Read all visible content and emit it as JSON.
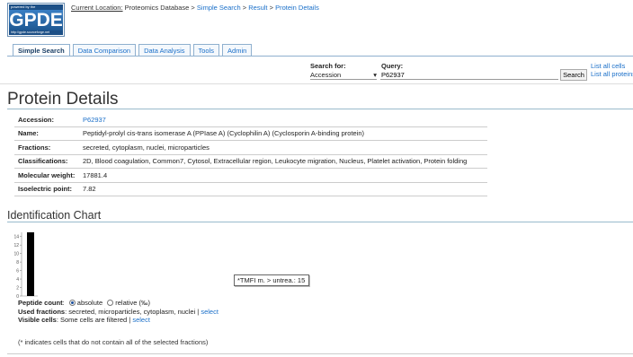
{
  "logo": {
    "top": "powered by the",
    "main": "GPDE",
    "bottom": "http://gpde.sourceforge.net"
  },
  "location": {
    "label": "Current Location:",
    "path": [
      "Proteomics Database",
      "Simple Search",
      "Result",
      "Protein Details"
    ],
    "separator": " > "
  },
  "tabs": [
    {
      "label": "Simple Search",
      "active": true
    },
    {
      "label": "Data Comparison",
      "active": false
    },
    {
      "label": "Data Analysis",
      "active": false
    },
    {
      "label": "Tools",
      "active": false
    },
    {
      "label": "Admin",
      "active": false
    }
  ],
  "search": {
    "for_label": "Search for:",
    "for_value": "Accession",
    "query_label": "Query:",
    "query_value": "P62937",
    "button": "Search",
    "list_cells": "List all cells",
    "list_proteins": "List all proteins"
  },
  "page_title": "Protein Details",
  "details": [
    {
      "key": "Accession:",
      "value": "P62937",
      "link": true
    },
    {
      "key": "Name:",
      "value": "Peptidyl-prolyl cis-trans isomerase A (PPIase A) (Cyclophilin A) (Cyclosporin A-binding protein)",
      "link": false
    },
    {
      "key": "Fractions:",
      "value": "secreted, cytoplasm, nuclei, microparticles",
      "link": false
    },
    {
      "key": "Classifications:",
      "value": "2D, Blood coagulation, Common7, Cytosol, Extracellular region, Leukocyte migration, Nucleus, Platelet activation, Protein folding",
      "link": false
    },
    {
      "key": "Molecular weight:",
      "value": "17881.4",
      "link": false
    },
    {
      "key": "Isoelectric point:",
      "value": "7.82",
      "link": false
    }
  ],
  "chart_title": "Identification Chart",
  "chart_data": {
    "type": "bar",
    "categories": [
      "*TMFI m. > untrea."
    ],
    "values": [
      15
    ],
    "ylim": [
      0,
      15
    ],
    "yticks": [
      0,
      2,
      4,
      6,
      8,
      10,
      12,
      14
    ],
    "tooltip": "*TMFI m. > untrea.: 15",
    "bar_color": "#000000"
  },
  "controls": {
    "peptide_label": "Peptide count",
    "absolute": "absolute",
    "relative": "relative (‰)",
    "used_label": "Used fractions",
    "used_value": "secreted, microparticles, cytoplasm, nuclei",
    "visible_label": "Visible cells",
    "visible_value": "Some cells are filtered",
    "select": "select",
    "pipe": "|"
  },
  "footnote": "(* indicates cells that do not contain all of the selected fractions)"
}
